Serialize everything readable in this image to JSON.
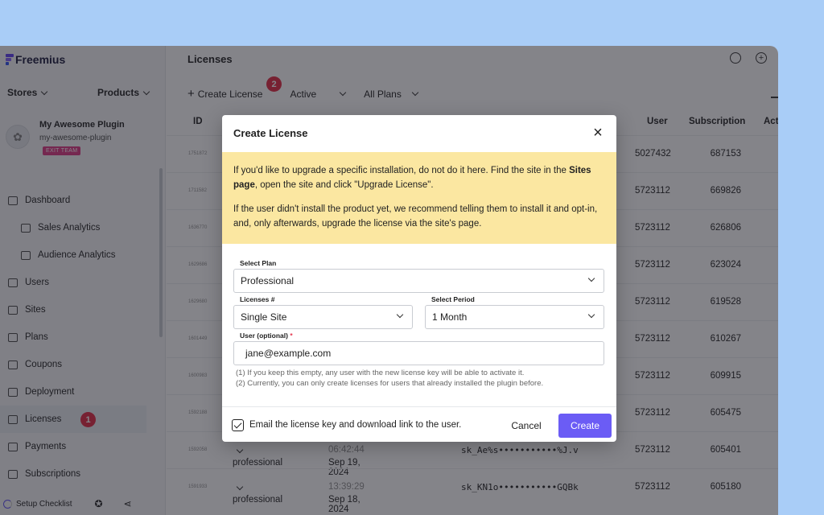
{
  "sidebar": {
    "brand": "Freemius",
    "stores_label": "Stores",
    "products_label": "Products",
    "plugin": {
      "name": "My Awesome Plugin",
      "slug": "my-awesome-plugin",
      "badge": "EXIT TEAM"
    },
    "items": [
      {
        "label": "Dashboard",
        "icon": "dashboard-icon"
      },
      {
        "label": "Sales Analytics",
        "icon": "sales-analytics-icon",
        "sub": true
      },
      {
        "label": "Audience Analytics",
        "icon": "audience-analytics-icon",
        "sub": true
      },
      {
        "label": "Users",
        "icon": "users-icon"
      },
      {
        "label": "Sites",
        "icon": "sites-icon"
      },
      {
        "label": "Plans",
        "icon": "plans-icon"
      },
      {
        "label": "Coupons",
        "icon": "coupons-icon"
      },
      {
        "label": "Deployment",
        "icon": "deployment-icon"
      },
      {
        "label": "Licenses",
        "icon": "key-icon",
        "active": true,
        "badge": "1"
      },
      {
        "label": "Payments",
        "icon": "payments-icon"
      },
      {
        "label": "Subscriptions",
        "icon": "subscriptions-icon"
      }
    ],
    "footer": {
      "checklist_label": "Setup Checklist"
    }
  },
  "main": {
    "title": "Licenses",
    "toolbar": {
      "create_label": "Create License",
      "status_filter": "Active",
      "plans_filter": "All Plans",
      "step_badge": "2"
    },
    "columns": {
      "id": "ID",
      "user": "User",
      "subscription": "Subscription",
      "actions": "Act"
    },
    "rows": [
      {
        "id": "1751872",
        "user": "5027432",
        "subscription": "687153"
      },
      {
        "id": "1711582",
        "user": "5723112",
        "subscription": "669826"
      },
      {
        "id": "1636770",
        "user": "5723112",
        "subscription": "626806"
      },
      {
        "id": "1629686",
        "user": "5723112",
        "subscription": "623024"
      },
      {
        "id": "1629680",
        "user": "5723112",
        "subscription": "619528"
      },
      {
        "id": "1601449",
        "user": "5723112",
        "subscription": "610267"
      },
      {
        "id": "1600983",
        "user": "5723112",
        "subscription": "609915"
      },
      {
        "id": "1592188",
        "user": "5723112",
        "subscription": "605475"
      },
      {
        "id": "1592058",
        "plan": "professional",
        "date": "Sep 19, 2024",
        "time": "06:42:44",
        "key": "sk_Ae%s•••••••••••%J.v",
        "user": "5723112",
        "subscription": "605401"
      },
      {
        "id": "1591933",
        "plan": "professional",
        "date": "Sep 18, 2024",
        "time": "13:39:29",
        "key": "sk_KN1o•••••••••••GQBk",
        "user": "5723112",
        "subscription": "605180"
      }
    ]
  },
  "modal": {
    "title": "Create License",
    "notice": {
      "p1_a": "If you'd like to upgrade a specific installation, do not do it here. Find the site in the ",
      "p1_bold": "Sites page",
      "p1_b": ", open the site and click \"Upgrade License\".",
      "p2": "If the user didn't install the product yet, we recommend telling them to install it and opt-in, and, only afterwards, upgrade the license via the site's page."
    },
    "plan": {
      "label": "Select Plan",
      "value": "Professional"
    },
    "licenses": {
      "label": "Licenses #",
      "value": "Single Site"
    },
    "period": {
      "label": "Select Period",
      "value": "1 Month"
    },
    "user": {
      "label": "User (optional)",
      "required_mark": "*",
      "value": "jane@example.com"
    },
    "hint1": "(1) If you keep this empty, any user with the new license key will be able to activate it.",
    "hint2": "(2) Currently, you can only create licenses for users that already installed the plugin before.",
    "email_checkbox_label": "Email the license key and download link to the user.",
    "cancel_label": "Cancel",
    "create_label": "Create"
  }
}
